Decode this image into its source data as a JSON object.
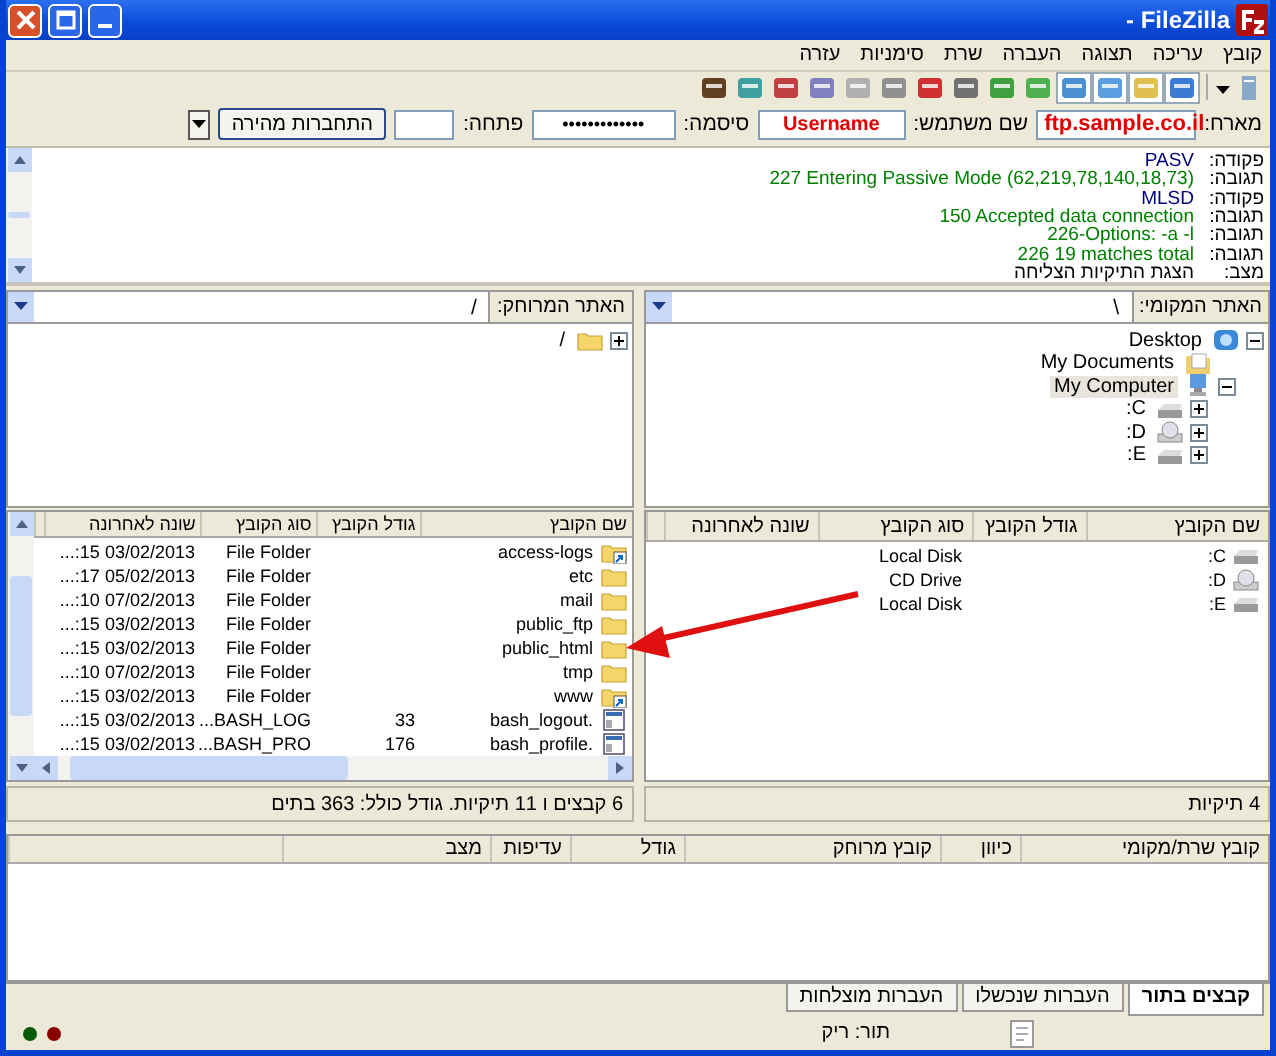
{
  "window": {
    "title": "- FileZilla"
  },
  "menu": [
    "קובץ",
    "עריכה",
    "תצוגה",
    "העברה",
    "שרת",
    "סימניות",
    "עזרה"
  ],
  "quickconnect": {
    "host_label": "מארח:",
    "host": "ftp.sample.co.il",
    "user_label": "שם משתמש:",
    "user": "Username",
    "password_label": "סיסמה:",
    "password": "•••••••••••••",
    "port_label": "פתחה:",
    "button": "התחברות מהירה"
  },
  "log": [
    {
      "kind": "command",
      "label": "פקודה:",
      "message": "PASV"
    },
    {
      "kind": "response",
      "label": "תגובה:",
      "message": "227 Entering Passive Mode (62,219,78,140,18,73)"
    },
    {
      "kind": "command",
      "label": "פקודה:",
      "message": "MLSD"
    },
    {
      "kind": "response",
      "label": "תגובה:",
      "message": "150 Accepted data connection"
    },
    {
      "kind": "response",
      "label": "תגובה:",
      "message": "226-Options: -a -l"
    },
    {
      "kind": "response",
      "label": "תגובה:",
      "message": "226 19 matches total"
    },
    {
      "kind": "status",
      "label": "מצב:",
      "message": "הצגת התיקיות הצליחה"
    }
  ],
  "local": {
    "site_label": "האתר המקומי:",
    "path": "\\",
    "tree": [
      {
        "name": "Desktop",
        "kind": "desktop",
        "expanded": true,
        "selected": false,
        "children": [
          {
            "name": "My Documents",
            "kind": "documents",
            "selected": false
          },
          {
            "name": "My Computer",
            "kind": "computer",
            "expanded": true,
            "selected": true,
            "children": [
              {
                "name": "C:",
                "kind": "disk",
                "expanded": false,
                "selected": false
              },
              {
                "name": "D:",
                "kind": "cd",
                "expanded": false,
                "selected": false
              },
              {
                "name": "E:",
                "kind": "disk",
                "expanded": false,
                "selected": false
              }
            ]
          }
        ]
      }
    ],
    "columns": [
      "שם הקובץ",
      "גודל הקובץ",
      "סוג הקובץ",
      "שונה לאחרונה"
    ],
    "files": [
      {
        "name": "C:",
        "kind": "disk",
        "type": "Local Disk"
      },
      {
        "name": "D:",
        "kind": "cd",
        "type": "CD Drive"
      },
      {
        "name": "E:",
        "kind": "disk",
        "type": "Local Disk"
      }
    ],
    "status": "4 תיקיות"
  },
  "remote": {
    "site_label": "האתר המרוחק:",
    "path": "/",
    "tree": [
      {
        "name": "/",
        "kind": "folder",
        "expanded": false,
        "selected": false
      }
    ],
    "columns": [
      "שם הקובץ",
      "גודל הקובץ",
      "סוג הקובץ",
      "שונה לאחרונה"
    ],
    "files": [
      {
        "name": "access-logs",
        "kind": "folder-link",
        "type": "File Folder",
        "modified": "03/02/2013 15:..."
      },
      {
        "name": "etc",
        "kind": "folder",
        "type": "File Folder",
        "modified": "05/02/2013 17:..."
      },
      {
        "name": "mail",
        "kind": "folder",
        "type": "File Folder",
        "modified": "07/02/2013 10:..."
      },
      {
        "name": "public_ftp",
        "kind": "folder",
        "type": "File Folder",
        "modified": "03/02/2013 15:..."
      },
      {
        "name": "public_html",
        "kind": "folder",
        "type": "File Folder",
        "modified": "03/02/2013 15:..."
      },
      {
        "name": "tmp",
        "kind": "folder",
        "type": "File Folder",
        "modified": "07/02/2013 10:..."
      },
      {
        "name": "www",
        "kind": "folder-link",
        "type": "File Folder",
        "modified": "03/02/2013 15:..."
      },
      {
        "name": ".bash_logout",
        "kind": "file",
        "size": "33",
        "type": "BASH_LOG...",
        "modified": "03/02/2013 15:..."
      },
      {
        "name": ".bash_profile",
        "kind": "file",
        "size": "176",
        "type": "BASH_PRO...",
        "modified": "03/02/2013 15:..."
      }
    ],
    "status": "6 קבצים ו 11 תיקיות. גודל כולל: 363 בתים"
  },
  "queue": {
    "columns": [
      "קובץ שרת/מקומי",
      "כיוון",
      "קובץ מרוחק",
      "גודל",
      "עדיפות",
      "מצב"
    ]
  },
  "tabs": [
    {
      "label": "קבצים בתור",
      "selected": true
    },
    {
      "label": "העברות שנכשלו",
      "selected": false
    },
    {
      "label": "העברות מוצלחות",
      "selected": false
    }
  ],
  "status_bar": {
    "queue": "תור: ריק"
  }
}
